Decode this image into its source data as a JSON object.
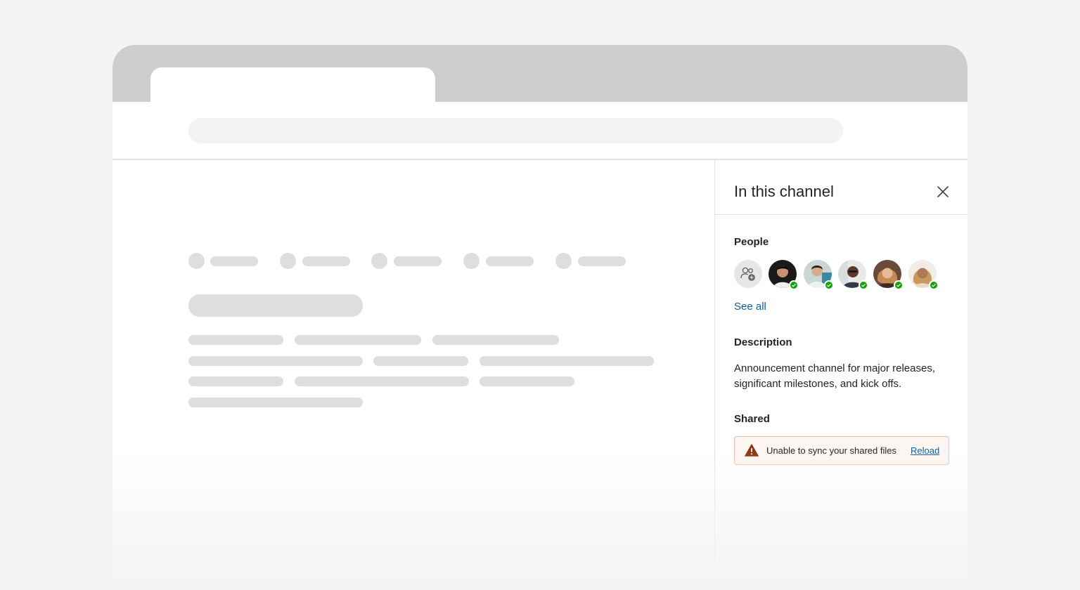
{
  "panel": {
    "title": "In this channel",
    "close_icon": "close-icon",
    "people": {
      "label": "People",
      "add_icon": "add-people-icon",
      "avatars": [
        {
          "name": "avatar-1",
          "status": "available"
        },
        {
          "name": "avatar-2",
          "status": "available"
        },
        {
          "name": "avatar-3",
          "status": "available"
        },
        {
          "name": "avatar-4",
          "status": "available"
        },
        {
          "name": "avatar-5",
          "status": "available"
        }
      ],
      "see_all": "See all"
    },
    "description": {
      "label": "Description",
      "text": "Announcement channel for major releases, significant milestones, and kick offs."
    },
    "shared": {
      "label": "Shared",
      "alert_icon": "warning-icon",
      "alert_text": "Unable to sync your shared files",
      "alert_action": "Reload"
    }
  },
  "colors": {
    "accent_link": "#115ea3",
    "presence_available": "#13a10e",
    "warning": "#8a3707",
    "alert_background": "#fdf6f3",
    "alert_border": "#f4bfab"
  }
}
